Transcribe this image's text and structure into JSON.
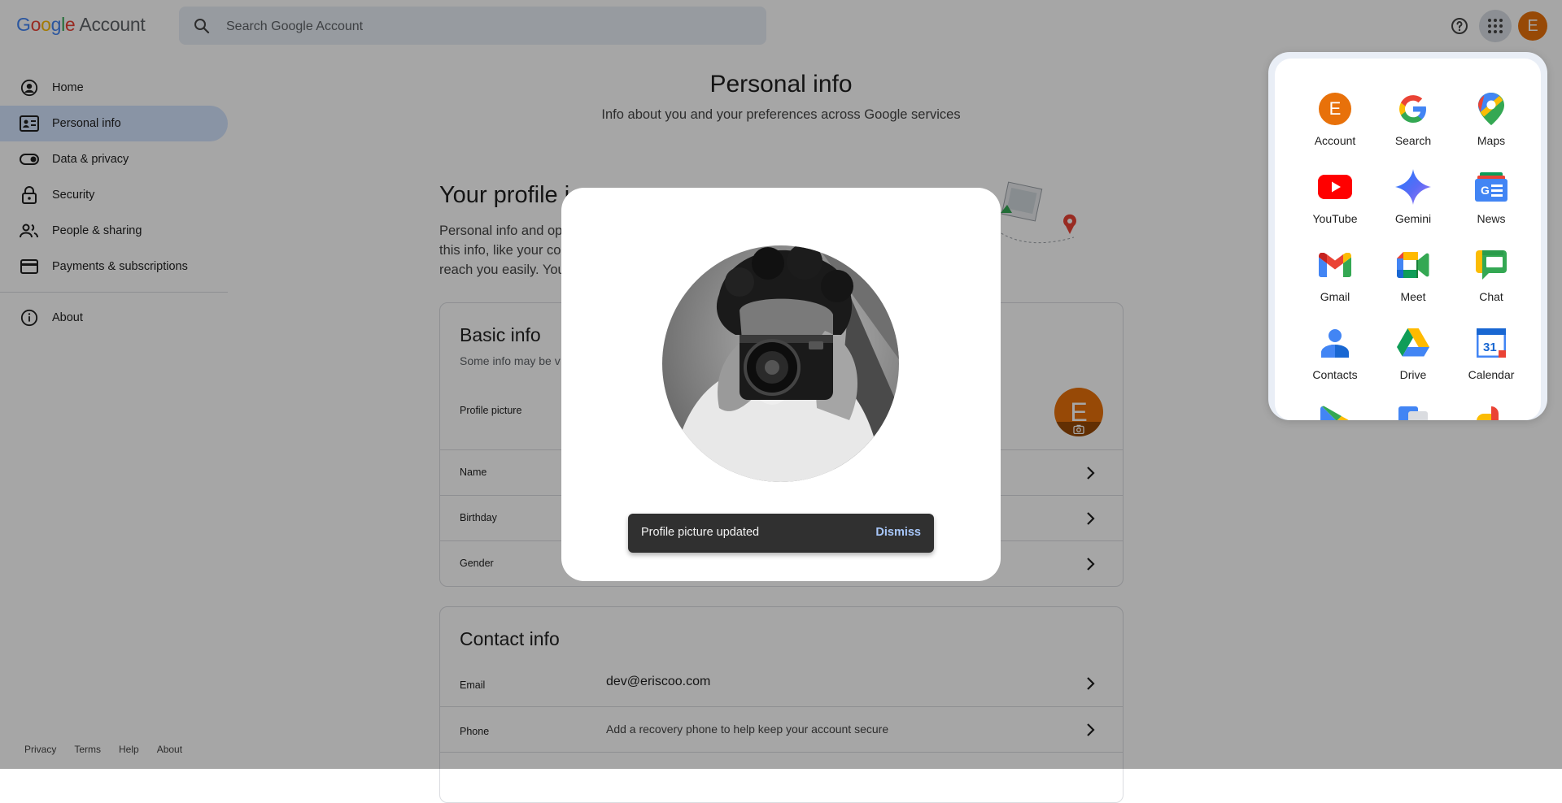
{
  "header": {
    "logo_google": "Google",
    "logo_account": "Account",
    "search_placeholder": "Search Google Account",
    "avatar_initial": "E"
  },
  "sidebar": {
    "items": [
      {
        "label": "Home",
        "icon": "account-circle-icon"
      },
      {
        "label": "Personal info",
        "icon": "badge-icon",
        "active": true
      },
      {
        "label": "Data & privacy",
        "icon": "toggle-icon"
      },
      {
        "label": "Security",
        "icon": "lock-icon"
      },
      {
        "label": "People & sharing",
        "icon": "people-icon"
      },
      {
        "label": "Payments & subscriptions",
        "icon": "credit-card-icon"
      }
    ],
    "about": {
      "label": "About",
      "icon": "info-icon"
    },
    "footer": [
      "Privacy",
      "Terms",
      "Help",
      "About"
    ]
  },
  "main": {
    "title": "Personal info",
    "subtitle": "Info about you and your preferences across Google services",
    "profile_title": "Your profile i",
    "profile_desc_lines": [
      "Personal info and opt",
      "this info, like your co",
      "reach you easily. You"
    ],
    "basic": {
      "title": "Basic info",
      "subtitle": "Some info may be v",
      "rows": [
        {
          "label": "Profile picture"
        },
        {
          "label": "Name"
        },
        {
          "label": "Birthday"
        },
        {
          "label": "Gender"
        }
      ],
      "avatar_initial": "E"
    },
    "contact": {
      "title": "Contact info",
      "rows": [
        {
          "label": "Email",
          "value": "dev@eriscoo.com"
        },
        {
          "label": "Phone",
          "value": "Add a recovery phone to help keep your account secure"
        }
      ]
    }
  },
  "apps_panel": {
    "apps": [
      {
        "label": "Account",
        "icon": "account-app-icon"
      },
      {
        "label": "Search",
        "icon": "google-search-icon"
      },
      {
        "label": "Maps",
        "icon": "maps-icon"
      },
      {
        "label": "YouTube",
        "icon": "youtube-icon"
      },
      {
        "label": "Gemini",
        "icon": "gemini-icon"
      },
      {
        "label": "News",
        "icon": "news-icon"
      },
      {
        "label": "Gmail",
        "icon": "gmail-icon"
      },
      {
        "label": "Meet",
        "icon": "meet-icon"
      },
      {
        "label": "Chat",
        "icon": "chat-icon"
      },
      {
        "label": "Contacts",
        "icon": "contacts-icon"
      },
      {
        "label": "Drive",
        "icon": "drive-icon"
      },
      {
        "label": "Calendar",
        "icon": "calendar-icon",
        "day": "31"
      }
    ],
    "account_initial": "E"
  },
  "dialog": {
    "snackbar_text": "Profile picture updated",
    "snackbar_action": "Dismiss"
  },
  "colors": {
    "accent": "#e8710a",
    "active_nav": "#d3e3fd",
    "snackbar_bg": "#303030",
    "snackbar_action": "#a8c7fa"
  }
}
